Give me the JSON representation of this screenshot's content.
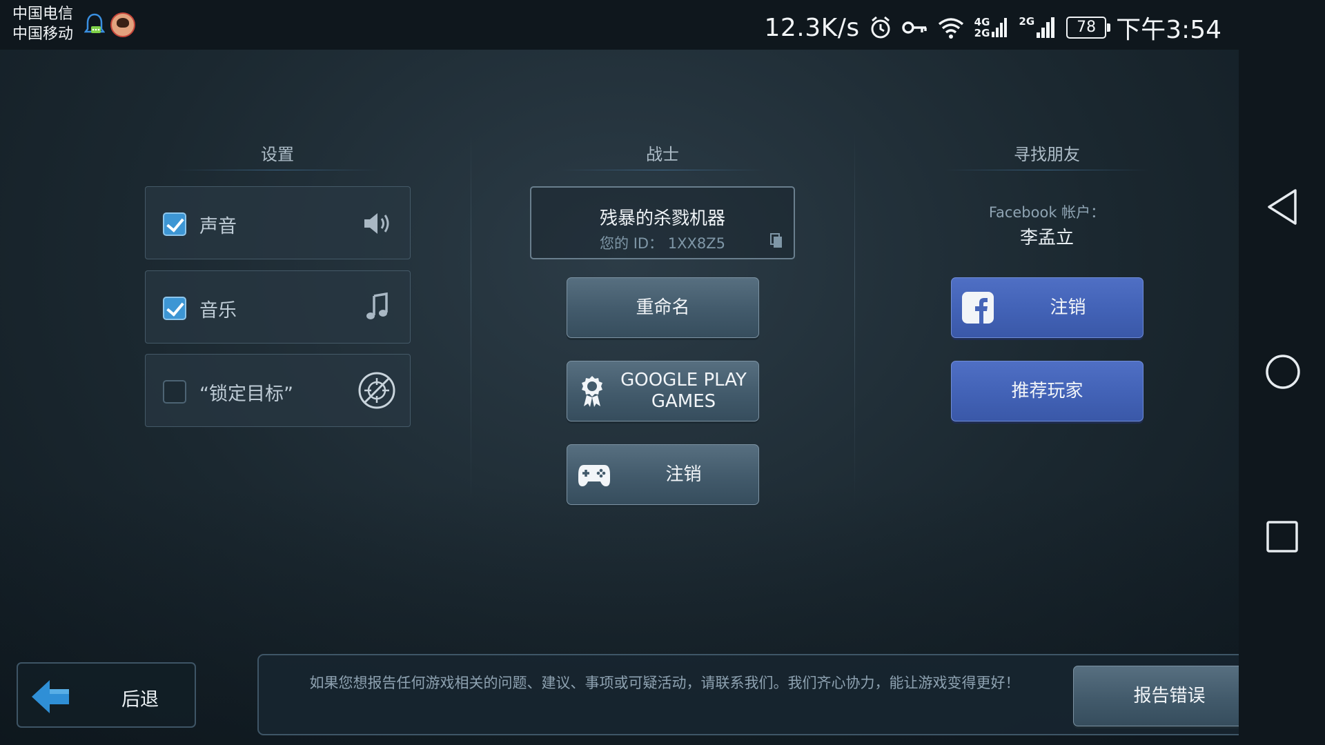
{
  "status_bar": {
    "carrier_1": "中国电信",
    "carrier_2": "中国移动",
    "net_speed": "12.3K/s",
    "net_type_1": "4G",
    "net_type_2": "2G",
    "net_type_3": "2G",
    "battery": "78",
    "time": "下午3:54"
  },
  "settings": {
    "title": "设置",
    "items": [
      {
        "label": "声音",
        "checked": true,
        "icon": "speaker-icon"
      },
      {
        "label": "音乐",
        "checked": true,
        "icon": "music-note-icon"
      },
      {
        "label": "“锁定目标”",
        "checked": false,
        "icon": "no-target-icon"
      }
    ]
  },
  "warrior": {
    "title": "战士",
    "name": "残暴的杀戮机器",
    "id_line": "您的 ID： 1XX8Z5",
    "rename_label": "重命名",
    "google_play_line1": "GOOGLE PLAY",
    "google_play_line2": "GAMES",
    "logout_label": "注销"
  },
  "friends": {
    "title": "寻找朋友",
    "facebook_label": "Facebook 帐户：",
    "facebook_name": "李孟立",
    "fb_logout_label": "注销",
    "recommend_label": "推荐玩家"
  },
  "bottom": {
    "back_label": "后退",
    "report_text": "如果您想报告任何游戏相关的问题、建议、事项或可疑活动，请联系我们。我们齐心协力，能让游戏变得更好！",
    "report_button": "报告错误"
  },
  "colors": {
    "checkbox_checked": "#3d96d4",
    "button_gray": "#4a6272",
    "button_blue": "#4565b8",
    "back_arrow": "#2f8fd6"
  }
}
